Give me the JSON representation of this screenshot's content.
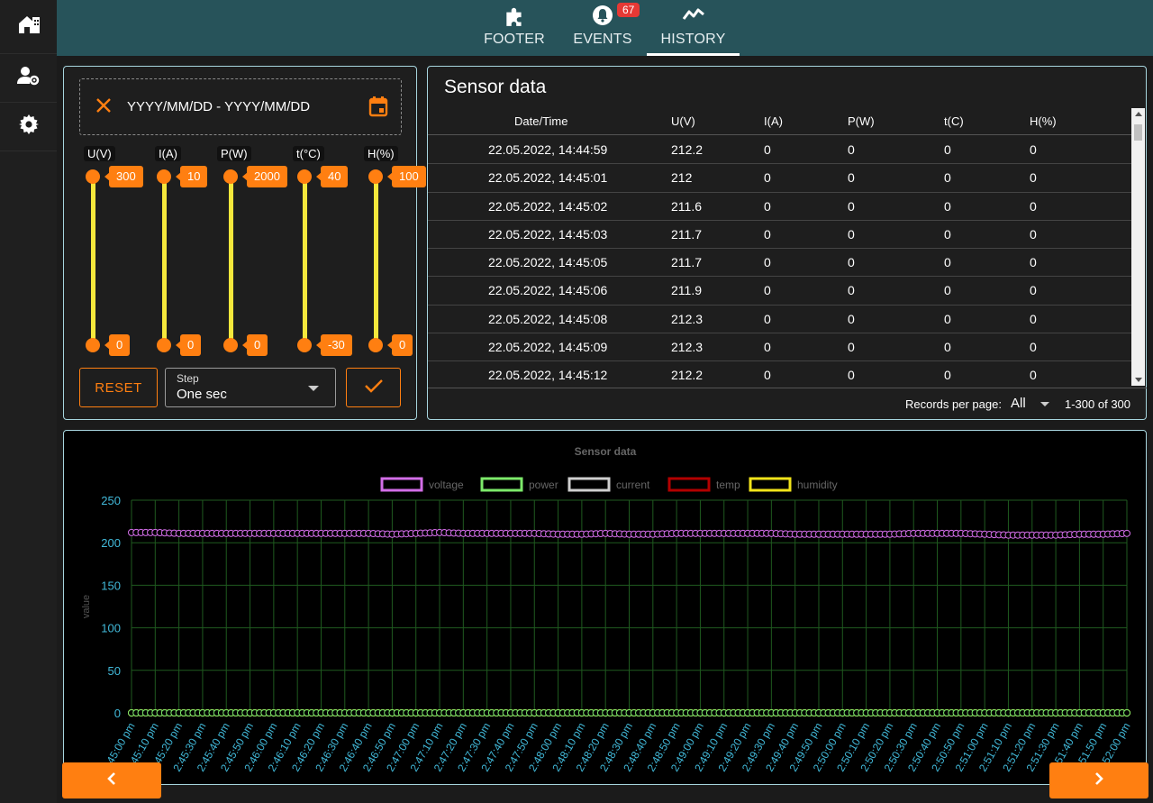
{
  "tabs": [
    {
      "label": "FOOTER",
      "icon": "puzzle-icon"
    },
    {
      "label": "EVENTS",
      "icon": "bell-icon",
      "badge": "67"
    },
    {
      "label": "HISTORY",
      "icon": "trend-icon",
      "active": true
    }
  ],
  "filter": {
    "date_placeholder": "YYYY/MM/DD - YYYY/MM/DD",
    "sliders": [
      {
        "label": "U(V)",
        "max": "300",
        "min": "0"
      },
      {
        "label": "I(A)",
        "max": "10",
        "min": "0"
      },
      {
        "label": "P(W)",
        "max": "2000",
        "min": "0"
      },
      {
        "label": "t(°C)",
        "max": "40",
        "min": "-30"
      },
      {
        "label": "H(%)",
        "max": "100",
        "min": "0"
      }
    ],
    "reset_label": "RESET",
    "step_label": "Step",
    "step_value": "One sec"
  },
  "table": {
    "title": "Sensor data",
    "columns": [
      "Date/Time",
      "U(V)",
      "I(A)",
      "P(W)",
      "t(C)",
      "H(%)"
    ],
    "rows": [
      [
        "22.05.2022, 14:44:59",
        "212.2",
        "0",
        "0",
        "0",
        "0"
      ],
      [
        "22.05.2022, 14:45:01",
        "212",
        "0",
        "0",
        "0",
        "0"
      ],
      [
        "22.05.2022, 14:45:02",
        "211.6",
        "0",
        "0",
        "0",
        "0"
      ],
      [
        "22.05.2022, 14:45:03",
        "211.7",
        "0",
        "0",
        "0",
        "0"
      ],
      [
        "22.05.2022, 14:45:05",
        "211.7",
        "0",
        "0",
        "0",
        "0"
      ],
      [
        "22.05.2022, 14:45:06",
        "211.9",
        "0",
        "0",
        "0",
        "0"
      ],
      [
        "22.05.2022, 14:45:08",
        "212.3",
        "0",
        "0",
        "0",
        "0"
      ],
      [
        "22.05.2022, 14:45:09",
        "212.3",
        "0",
        "0",
        "0",
        "0"
      ],
      [
        "22.05.2022, 14:45:12",
        "212.2",
        "0",
        "0",
        "0",
        "0"
      ]
    ],
    "records_per_page_label": "Records per page:",
    "records_per_page_value": "All",
    "range_text": "1-300 of 300"
  },
  "chart_data": {
    "type": "line",
    "title": "Sensor data",
    "ylabel": "value",
    "ylim": [
      0,
      250
    ],
    "yticks": [
      0,
      50,
      100,
      150,
      200,
      250
    ],
    "grid": true,
    "legend_position": "top",
    "categories": [
      "2:45:00 pm",
      "2:45:10 pm",
      "2:45:20 pm",
      "2:45:30 pm",
      "2:45:40 pm",
      "2:45:50 pm",
      "2:46:00 pm",
      "2:46:10 pm",
      "2:46:20 pm",
      "2:46:30 pm",
      "2:46:40 pm",
      "2:46:50 pm",
      "2:47:00 pm",
      "2:47:10 pm",
      "2:47:20 pm",
      "2:47:30 pm",
      "2:47:40 pm",
      "2:47:50 pm",
      "2:48:00 pm",
      "2:48:10 pm",
      "2:48:20 pm",
      "2:48:30 pm",
      "2:48:40 pm",
      "2:48:50 pm",
      "2:49:00 pm",
      "2:49:10 pm",
      "2:49:20 pm",
      "2:49:30 pm",
      "2:49:40 pm",
      "2:49:50 pm",
      "2:50:00 pm",
      "2:50:10 pm",
      "2:50:20 pm",
      "2:50:30 pm",
      "2:50:40 pm",
      "2:50:50 pm",
      "2:51:00 pm",
      "2:51:10 pm",
      "2:51:20 pm",
      "2:51:30 pm",
      "2:51:40 pm",
      "2:51:50 pm",
      "2:52:00 pm"
    ],
    "series": [
      {
        "name": "voltage",
        "color": "#d36ee8",
        "values": [
          212,
          212,
          211,
          211,
          211,
          211,
          211,
          211,
          211,
          211,
          211,
          210,
          211,
          212,
          211,
          211,
          211,
          211,
          210,
          210,
          211,
          210,
          210,
          211,
          211,
          211,
          211,
          211,
          210,
          210,
          210,
          210,
          210,
          211,
          211,
          211,
          210,
          209,
          209,
          209,
          210,
          210,
          211
        ]
      },
      {
        "name": "power",
        "color": "#7dea6a",
        "values": [
          0,
          0,
          0,
          0,
          0,
          0,
          0,
          0,
          0,
          0,
          0,
          0,
          0,
          0,
          0,
          0,
          0,
          0,
          0,
          0,
          0,
          0,
          0,
          0,
          0,
          0,
          0,
          0,
          0,
          0,
          0,
          0,
          0,
          0,
          0,
          0,
          0,
          0,
          0,
          0,
          0,
          0,
          0
        ]
      },
      {
        "name": "current",
        "color": "#cfcfcf",
        "values": [
          0,
          0,
          0,
          0,
          0,
          0,
          0,
          0,
          0,
          0,
          0,
          0,
          0,
          0,
          0,
          0,
          0,
          0,
          0,
          0,
          0,
          0,
          0,
          0,
          0,
          0,
          0,
          0,
          0,
          0,
          0,
          0,
          0,
          0,
          0,
          0,
          0,
          0,
          0,
          0,
          0,
          0,
          0
        ]
      },
      {
        "name": "temp",
        "color": "#b30000",
        "values": [
          0,
          0,
          0,
          0,
          0,
          0,
          0,
          0,
          0,
          0,
          0,
          0,
          0,
          0,
          0,
          0,
          0,
          0,
          0,
          0,
          0,
          0,
          0,
          0,
          0,
          0,
          0,
          0,
          0,
          0,
          0,
          0,
          0,
          0,
          0,
          0,
          0,
          0,
          0,
          0,
          0,
          0,
          0
        ]
      },
      {
        "name": "humidity",
        "color": "#f2e41a",
        "values": [
          0,
          0,
          0,
          0,
          0,
          0,
          0,
          0,
          0,
          0,
          0,
          0,
          0,
          0,
          0,
          0,
          0,
          0,
          0,
          0,
          0,
          0,
          0,
          0,
          0,
          0,
          0,
          0,
          0,
          0,
          0,
          0,
          0,
          0,
          0,
          0,
          0,
          0,
          0,
          0,
          0,
          0,
          0
        ]
      }
    ]
  }
}
